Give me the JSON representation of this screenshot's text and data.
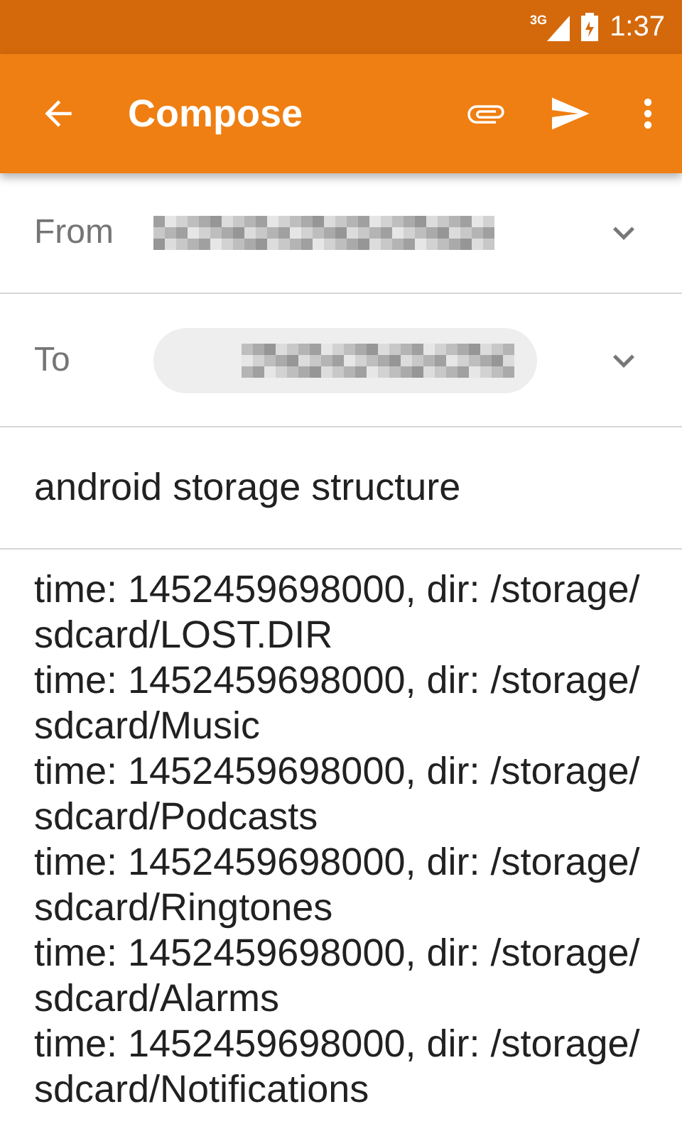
{
  "status_bar": {
    "network": "3G",
    "time": "1:37"
  },
  "toolbar": {
    "title": "Compose"
  },
  "from": {
    "label": "From"
  },
  "to": {
    "label": "To"
  },
  "subject": {
    "value": "android storage structure"
  },
  "body": {
    "lines": [
      "time: 1452459698000, dir: /storage/",
      "sdcard/LOST.DIR",
      "time: 1452459698000, dir: /storage/",
      "sdcard/Music",
      "time: 1452459698000, dir: /storage/",
      "sdcard/Podcasts",
      "time: 1452459698000, dir: /storage/",
      "sdcard/Ringtones",
      "time: 1452459698000, dir: /storage/",
      "sdcard/Alarms",
      "time: 1452459698000, dir: /storage/",
      "sdcard/Notifications"
    ]
  }
}
